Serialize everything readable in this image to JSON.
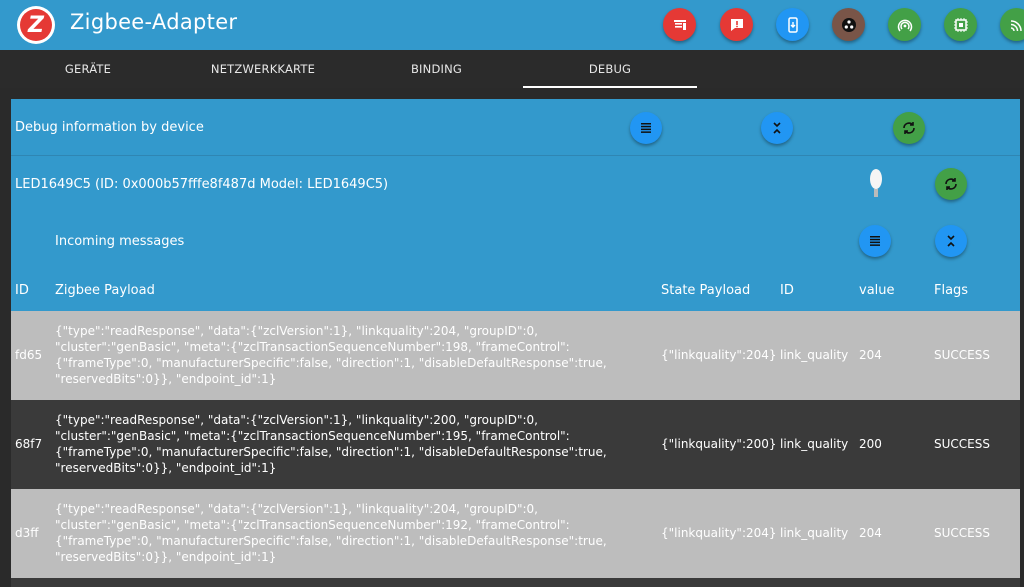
{
  "header": {
    "title": "Zigbee-Adapter",
    "logo_letter": "Z",
    "buttons": [
      {
        "name": "delete-icon",
        "color": "#e53935"
      },
      {
        "name": "message-icon",
        "color": "#e53935"
      },
      {
        "name": "phone-icon",
        "color": "#2196f3"
      },
      {
        "name": "dots-icon",
        "color": "#795548"
      },
      {
        "name": "signal-icon",
        "color": "#43a047"
      },
      {
        "name": "chip-icon",
        "color": "#43a047"
      },
      {
        "name": "wifi-icon",
        "color": "#43a047"
      }
    ]
  },
  "tabs": [
    {
      "label": "GERÄTE"
    },
    {
      "label": "NETZWERKKARTE"
    },
    {
      "label": "BINDING"
    },
    {
      "label": "DEBUG",
      "active": true
    }
  ],
  "debug": {
    "title": "Debug information by device"
  },
  "device": {
    "label": "LED1649C5 (ID: 0x000b57fffe8f487d Model: LED1649C5)",
    "icon": "bulb-icon"
  },
  "incoming": {
    "title": "Incoming messages"
  },
  "table": {
    "headers": {
      "id": "ID",
      "zigbee": "Zigbee Payload",
      "state": "State Payload",
      "id2": "ID",
      "value": "value",
      "flags": "Flags"
    },
    "rows": [
      {
        "id": "fd65",
        "zigbee": "{\"type\":\"readResponse\", \"data\":{\"zclVersion\":1}, \"linkquality\":204, \"groupID\":0,\n\"cluster\":\"genBasic\", \"meta\":{\"zclTransactionSequenceNumber\":198, \"frameControl\":\n{\"frameType\":0, \"manufacturerSpecific\":false, \"direction\":1, \"disableDefaultResponse\":true,\n\"reservedBits\":0}}, \"endpoint_id\":1}",
        "state": "{\"linkquality\":204}",
        "attr": "link_quality",
        "value": "204",
        "flags": "SUCCESS"
      },
      {
        "id": "68f7",
        "zigbee": "{\"type\":\"readResponse\", \"data\":{\"zclVersion\":1}, \"linkquality\":200, \"groupID\":0,\n\"cluster\":\"genBasic\", \"meta\":{\"zclTransactionSequenceNumber\":195, \"frameControl\":\n{\"frameType\":0, \"manufacturerSpecific\":false, \"direction\":1, \"disableDefaultResponse\":true,\n\"reservedBits\":0}}, \"endpoint_id\":1}",
        "state": "{\"linkquality\":200}",
        "attr": "link_quality",
        "value": "200",
        "flags": "SUCCESS"
      },
      {
        "id": "d3ff",
        "zigbee": "{\"type\":\"readResponse\", \"data\":{\"zclVersion\":1}, \"linkquality\":204, \"groupID\":0,\n\"cluster\":\"genBasic\", \"meta\":{\"zclTransactionSequenceNumber\":192, \"frameControl\":\n{\"frameType\":0, \"manufacturerSpecific\":false, \"direction\":1, \"disableDefaultResponse\":true,\n\"reservedBits\":0}}, \"endpoint_id\":1}",
        "state": "{\"linkquality\":204}",
        "attr": "link_quality",
        "value": "204",
        "flags": "SUCCESS"
      }
    ]
  }
}
